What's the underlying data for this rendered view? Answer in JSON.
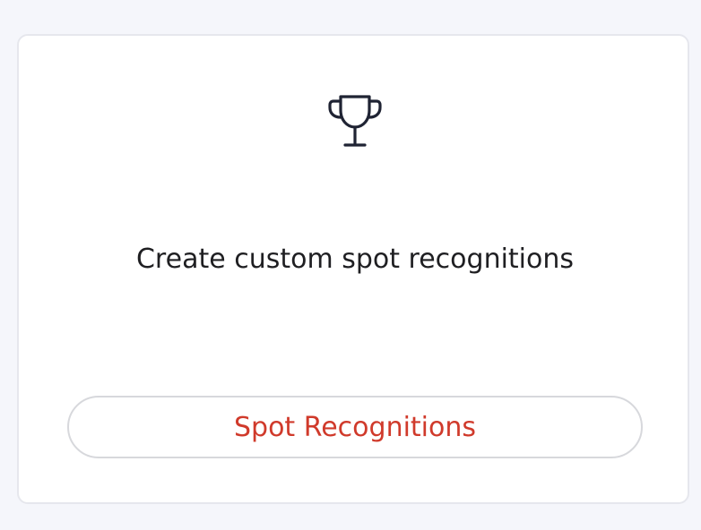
{
  "card": {
    "icon": "trophy-icon",
    "description": "Create custom spot recognitions",
    "button_label": "Spot Recognitions"
  },
  "colors": {
    "accent": "#d03a2b",
    "icon": "#1f2333",
    "text": "#1f1f22",
    "background": "#f5f6fb",
    "card_border": "#e6e7ed"
  }
}
